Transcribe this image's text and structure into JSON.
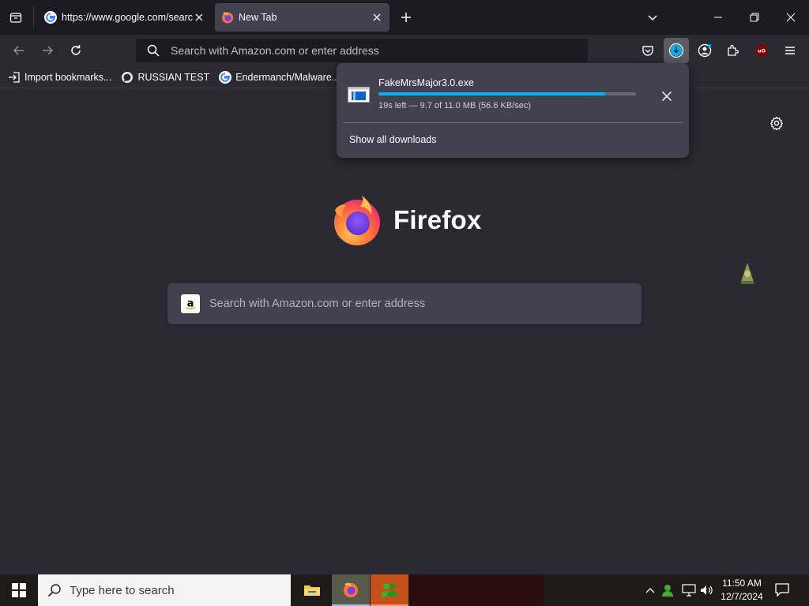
{
  "tabs": [
    {
      "title": "https://www.google.com/search",
      "favicon": "google-icon",
      "active": false
    },
    {
      "title": "New Tab",
      "favicon": "firefox-icon",
      "active": true
    }
  ],
  "navbar": {
    "url_placeholder": "Search with Amazon.com or enter address"
  },
  "bookmarks": [
    {
      "label": "Import bookmarks...",
      "icon": "import-icon"
    },
    {
      "label": "RUSSIAN TEST",
      "icon": "github-icon"
    },
    {
      "label": "Endermanch/Malware...",
      "icon": "google-icon"
    }
  ],
  "newtab": {
    "brand": "Firefox",
    "search_placeholder": "Search with Amazon.com or enter address"
  },
  "download": {
    "filename": "FakeMrsMajor3.0.exe",
    "status": "19s left — 9.7 of 11.0 MB (56.6 KB/sec)",
    "progress": 0.88,
    "show_all_label": "Show all downloads"
  },
  "taskbar": {
    "search_placeholder": "Type here to search",
    "time": "11:50 AM",
    "date": "12/7/2024"
  },
  "colors": {
    "accent": "#00b3f4",
    "chrome_dark": "#1c1b22",
    "content_bg": "#2b2a33",
    "panel_bg": "#42414d"
  }
}
